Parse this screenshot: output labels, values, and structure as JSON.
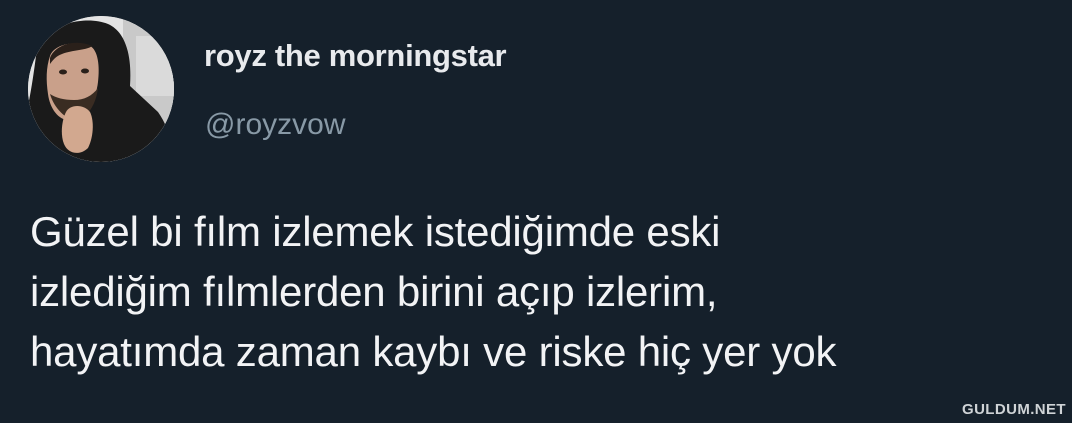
{
  "tweet": {
    "author": {
      "display_name": "royz the morningstar",
      "handle": "@royzvow"
    },
    "text_lines": [
      "Güzel bi fılm izlemek istediğimde eski",
      "izlediğim fılmlerden birini açıp izlerim,",
      "hayatımda zaman kaybı ve riske hiç yer yok"
    ]
  },
  "watermark": "GULDUM.NET",
  "colors": {
    "background": "#15202b",
    "display_name": "#e8eaed",
    "handle": "#8899a6",
    "text": "#f2f3f5"
  }
}
